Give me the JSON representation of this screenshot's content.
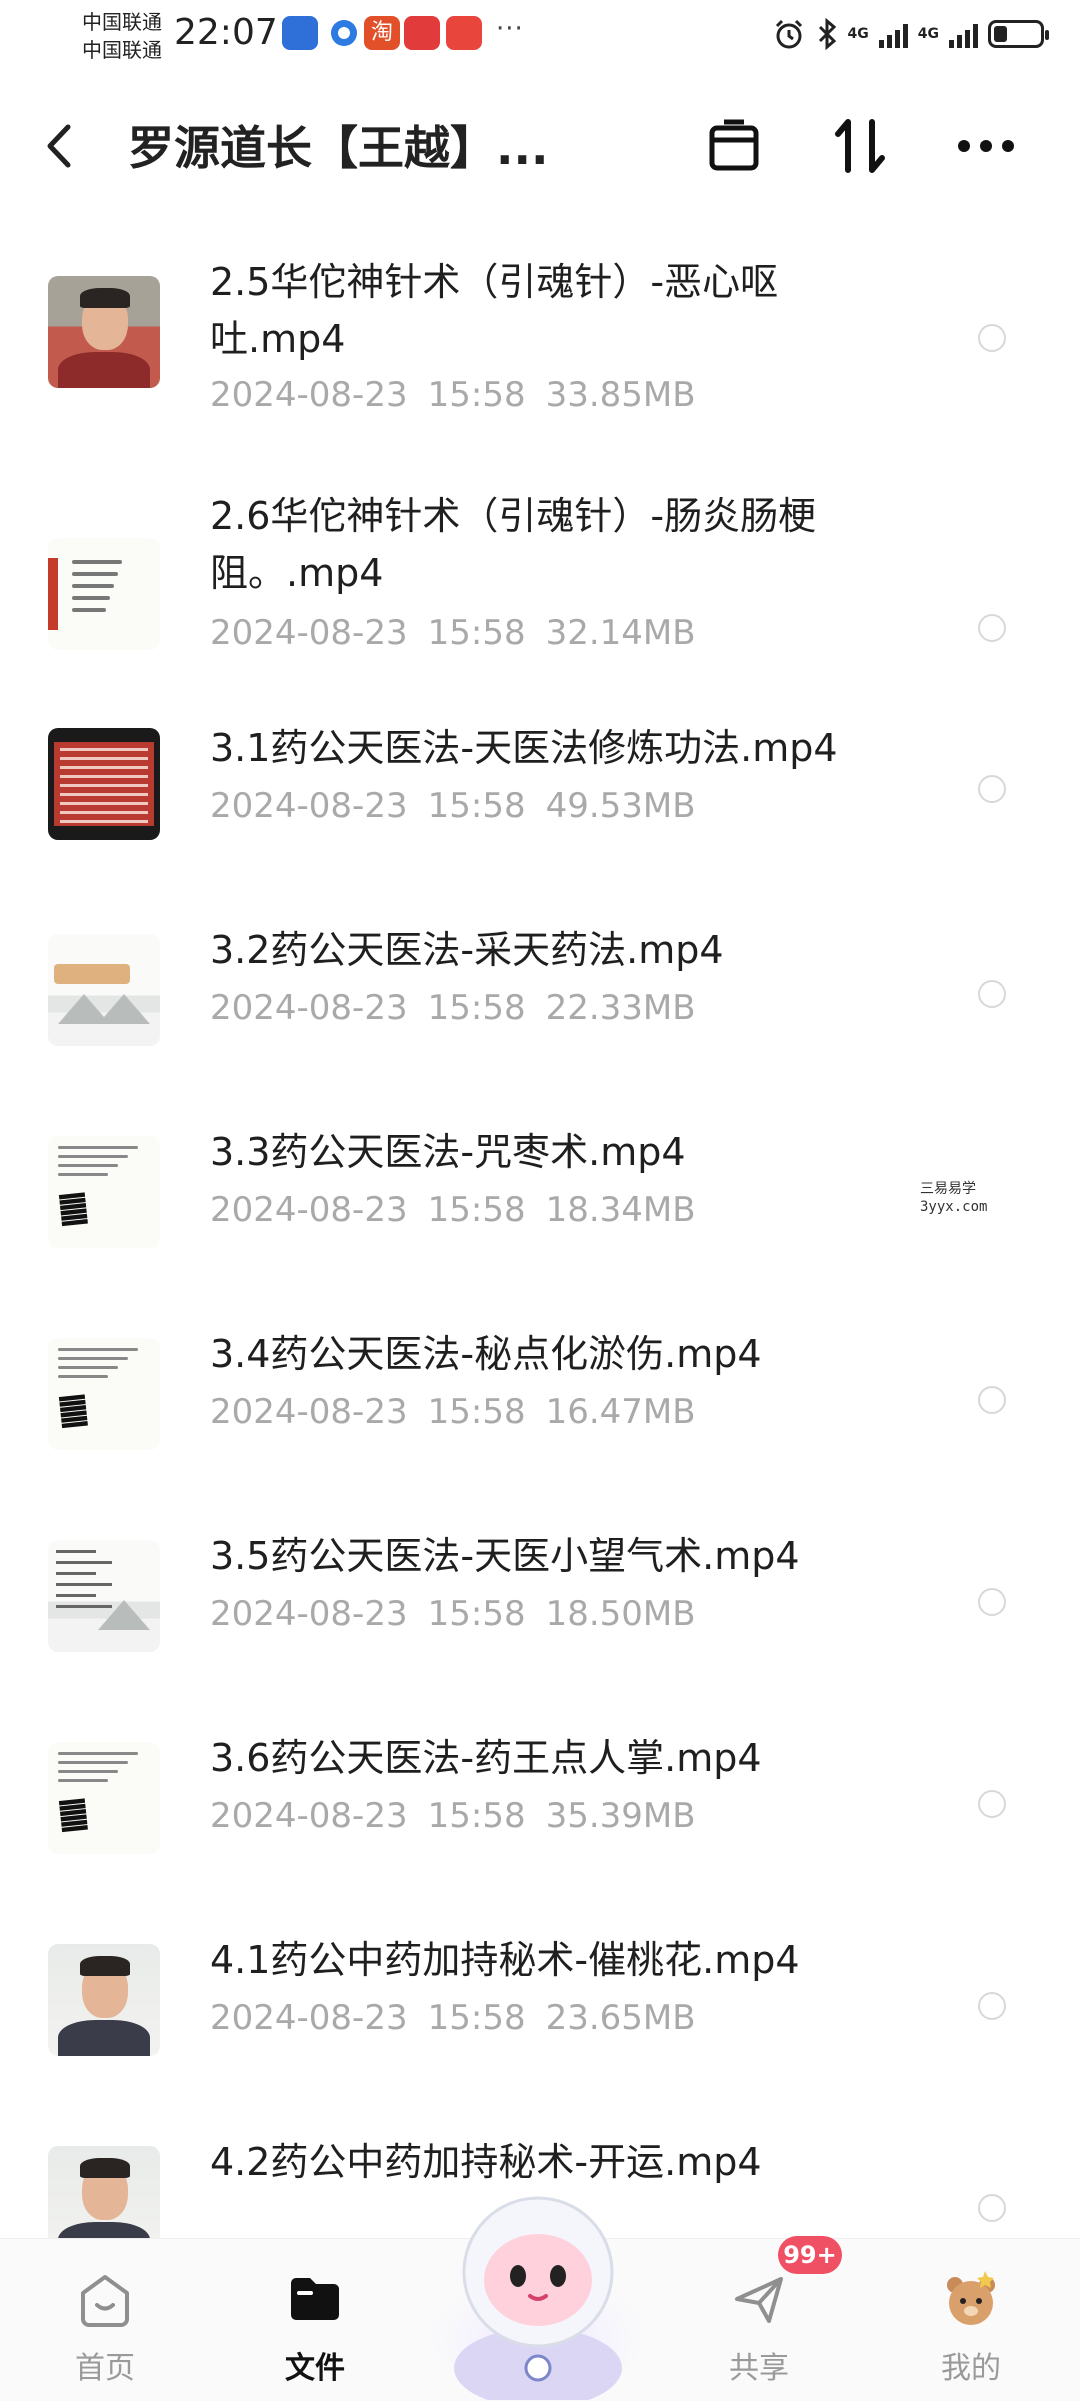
{
  "status_bar": {
    "carrier1": "中国联通",
    "carrier2": "中国联通",
    "time": "22:07",
    "network1": "4G",
    "network2": "4G",
    "more": "···",
    "battery_level": 0.3,
    "notification_icons": [
      "shield-app-icon",
      "browser-app-icon",
      "taobao-app-icon",
      "huawei-app-icon",
      "jd-app-icon"
    ]
  },
  "header": {
    "back_label": "‹",
    "title": "罗源道长【王越】..."
  },
  "files": [
    {
      "name": "2.5华佗神针术（引魂针）-恶心呕吐.mp4",
      "date": "2024-08-23",
      "time": "15:58",
      "size": "33.85MB",
      "thumb": "person-red"
    },
    {
      "name": "2.6华佗神针术（引魂针）-肠炎肠梗阻。.mp4",
      "date": "2024-08-23",
      "time": "15:58",
      "size": "32.14MB",
      "thumb": "text-slide"
    },
    {
      "name": "3.1药公天医法-天医法修炼功法.mp4",
      "date": "2024-08-23",
      "time": "15:58",
      "size": "49.53MB",
      "thumb": "red-slide"
    },
    {
      "name": "3.2药公天医法-采天药法.mp4",
      "date": "2024-08-23",
      "time": "15:58",
      "size": "22.33MB",
      "thumb": "landscape-title"
    },
    {
      "name": "3.3药公天医法-咒枣术.mp4",
      "date": "2024-08-23",
      "time": "15:58",
      "size": "18.34MB",
      "thumb": "calligraphy"
    },
    {
      "name": "3.4药公天医法-秘点化淤伤.mp4",
      "date": "2024-08-23",
      "time": "15:58",
      "size": "16.47MB",
      "thumb": "calligraphy"
    },
    {
      "name": "3.5药公天医法-天医小望气术.mp4",
      "date": "2024-08-23",
      "time": "15:58",
      "size": "18.50MB",
      "thumb": "landscape-text"
    },
    {
      "name": "3.6药公天医法-药王点人掌.mp4",
      "date": "2024-08-23",
      "time": "15:58",
      "size": "35.39MB",
      "thumb": "calligraphy"
    },
    {
      "name": "4.1药公中药加持秘术-催桃花.mp4",
      "date": "2024-08-23",
      "time": "15:58",
      "size": "23.65MB",
      "thumb": "person-light"
    },
    {
      "name": "4.2药公中药加持秘术-开运.mp4",
      "date": "",
      "time": "",
      "size": "",
      "thumb": "person-light"
    }
  ],
  "watermark": {
    "line1": "三易易学",
    "line2": "3yyx.com"
  },
  "bottom_nav": {
    "home": "首页",
    "files": "文件",
    "share": "共享",
    "mine": "我的",
    "share_badge": "99+"
  },
  "colors": {
    "badge": "#f05063",
    "meta_text": "#a9a9a9",
    "active_label": "#111111",
    "inactive_label": "#9a9a9a"
  }
}
